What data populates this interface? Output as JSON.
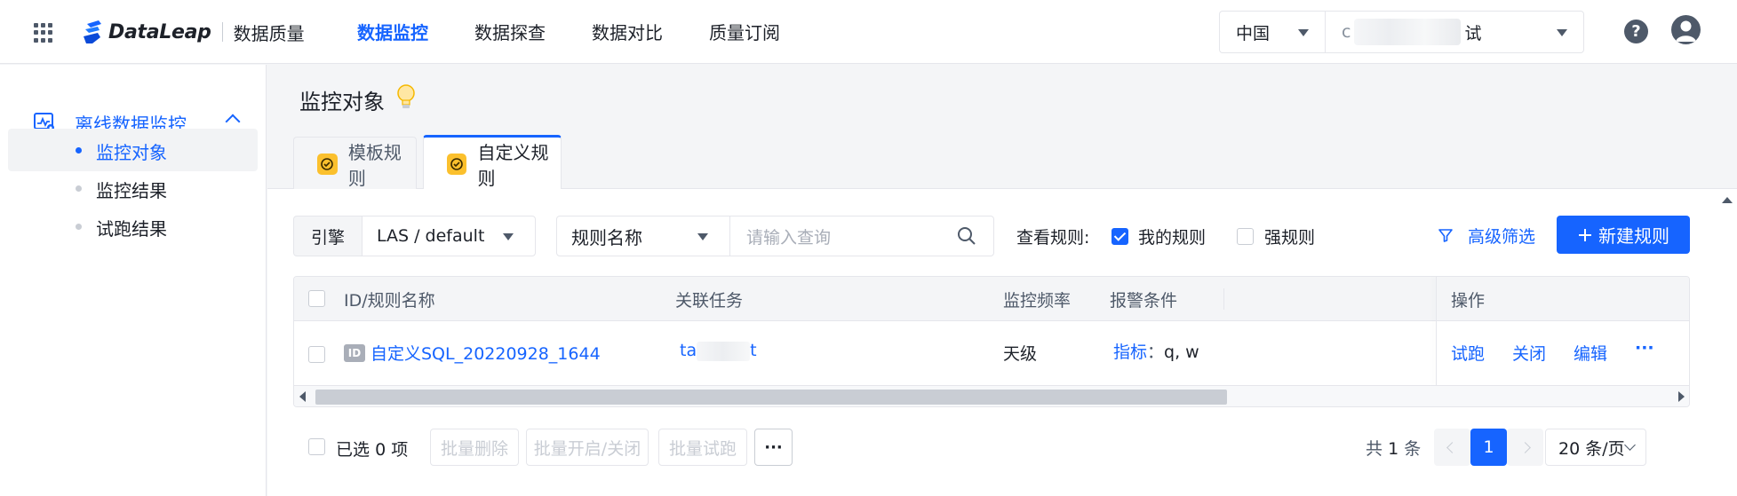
{
  "header": {
    "logo_text": "DataLeap",
    "product_name": "数据质量",
    "nav": [
      "数据监控",
      "数据探查",
      "数据对比",
      "质量订阅"
    ],
    "active_nav": 0,
    "region": "中国",
    "project_prefix": "c",
    "project_suffix": "试",
    "help_symbol": "?"
  },
  "sidebar": {
    "group_label": "离线数据监控",
    "items": [
      {
        "label": "监控对象",
        "active": true
      },
      {
        "label": "监控结果",
        "active": false
      },
      {
        "label": "试跑结果",
        "active": false
      }
    ]
  },
  "page": {
    "title": "监控对象",
    "tabs": [
      {
        "label": "模板规则",
        "active": false
      },
      {
        "label": "自定义规则",
        "active": true
      }
    ]
  },
  "filters": {
    "engine_label": "引擎",
    "engine_value": "LAS / default",
    "field_value": "规则名称",
    "search_placeholder": "请输入查询",
    "view_label": "查看规则:",
    "my_rules_label": "我的规则",
    "my_rules_checked": true,
    "strong_rules_label": "强规则",
    "strong_rules_checked": false,
    "advanced_filter_label": "高级筛选",
    "new_rule_label": "新建规则"
  },
  "table": {
    "columns": [
      "ID/规则名称",
      "关联任务",
      "监控频率",
      "报警条件",
      "操作"
    ],
    "rows": [
      {
        "id_badge": "ID",
        "name": "自定义SQL_20220928_1644",
        "task_prefix": "ta",
        "task_suffix": "t",
        "frequency": "天级",
        "alarm_label": "指标",
        "alarm_value": "q, w",
        "actions": [
          "试跑",
          "关闭",
          "编辑",
          "···"
        ]
      }
    ]
  },
  "footer": {
    "selected_prefix": "已选",
    "selected_count": "0",
    "selected_suffix": "项",
    "batch_buttons": [
      "批量删除",
      "批量开启/关闭",
      "批量试跑"
    ],
    "more_label": "···",
    "total_prefix": "共",
    "total_count": "1",
    "total_suffix": "条",
    "current_page": "1",
    "page_size": "20 条/页"
  },
  "colors": {
    "accent": "#1664ff",
    "text": "#1d2129",
    "muted": "#4e5969",
    "border": "#e5e6eb",
    "tab_icon": "#fbc02d"
  }
}
